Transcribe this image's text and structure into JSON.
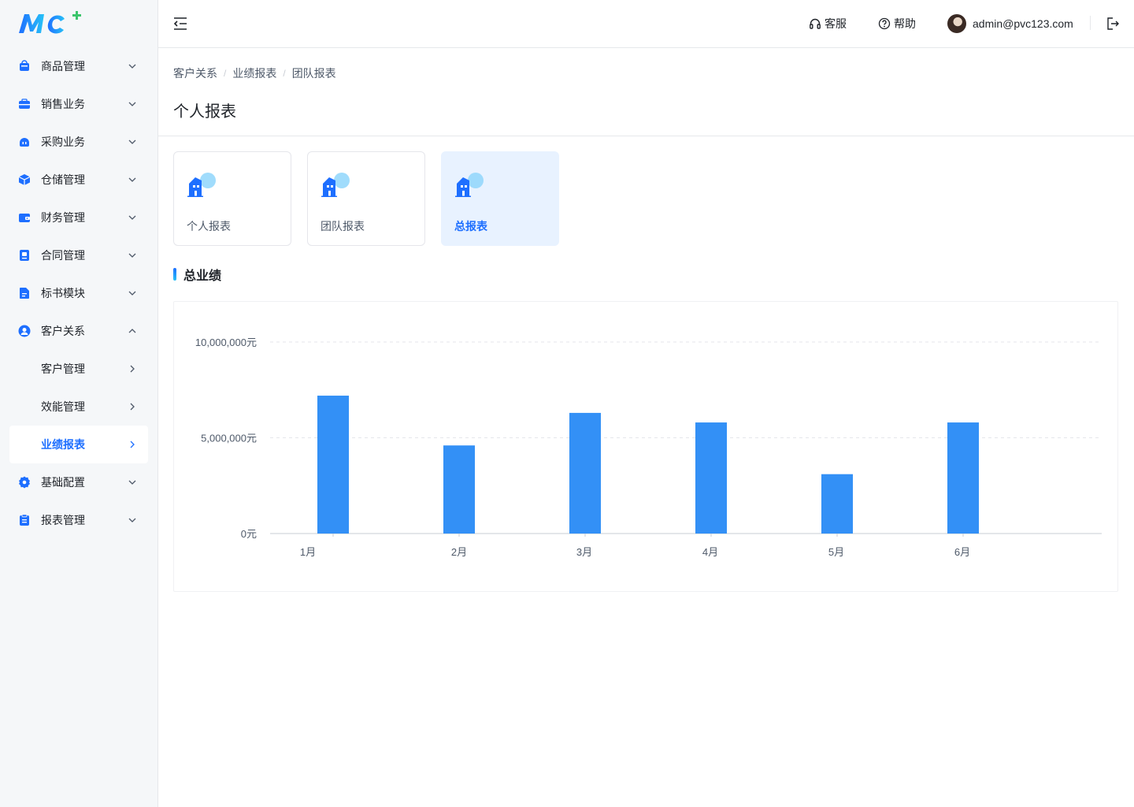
{
  "brand": {
    "logo_text": "MC",
    "plus": "+"
  },
  "sidebar": {
    "items": [
      {
        "label": "商品管理",
        "icon": "bag-icon",
        "expanded": false
      },
      {
        "label": "销售业务",
        "icon": "briefcase-icon",
        "expanded": false
      },
      {
        "label": "采购业务",
        "icon": "cart-icon",
        "expanded": false
      },
      {
        "label": "仓储管理",
        "icon": "cube-icon",
        "expanded": false
      },
      {
        "label": "财务管理",
        "icon": "wallet-icon",
        "expanded": false
      },
      {
        "label": "合同管理",
        "icon": "contract-icon",
        "expanded": false
      },
      {
        "label": "标书模块",
        "icon": "document-icon",
        "expanded": false
      },
      {
        "label": "客户关系",
        "icon": "user-circle-icon",
        "expanded": true,
        "children": [
          {
            "label": "客户管理"
          },
          {
            "label": "效能管理"
          },
          {
            "label": "业绩报表",
            "active": true
          }
        ]
      },
      {
        "label": "基础配置",
        "icon": "gear-icon",
        "expanded": false
      },
      {
        "label": "报表管理",
        "icon": "clipboard-icon",
        "expanded": false
      }
    ]
  },
  "header": {
    "service_label": "客服",
    "help_label": "帮助",
    "user_email": "admin@pvc123.com"
  },
  "breadcrumb": [
    "客户关系",
    "业绩报表",
    "团队报表"
  ],
  "page_title": "个人报表",
  "report_cards": [
    {
      "label": "个人报表",
      "active": false
    },
    {
      "label": "团队报表",
      "active": false
    },
    {
      "label": "总报表",
      "active": true
    }
  ],
  "section_title": "总业绩",
  "colors": {
    "accent": "#1e6fff",
    "bar": "#3390f6",
    "active_bg": "#e8f2ff"
  },
  "chart_data": {
    "type": "bar",
    "categories": [
      "1月",
      "2月",
      "3月",
      "4月",
      "5月",
      "6月"
    ],
    "values": [
      7200000,
      4600000,
      6300000,
      5800000,
      3100000,
      5800000
    ],
    "ylim": [
      0,
      10000000
    ],
    "yticks": [
      0,
      5000000,
      10000000
    ],
    "ytick_labels": [
      "0元",
      "5,000,000元",
      "10,000,000元"
    ],
    "grid": true,
    "title": "",
    "xlabel": "",
    "ylabel": ""
  }
}
